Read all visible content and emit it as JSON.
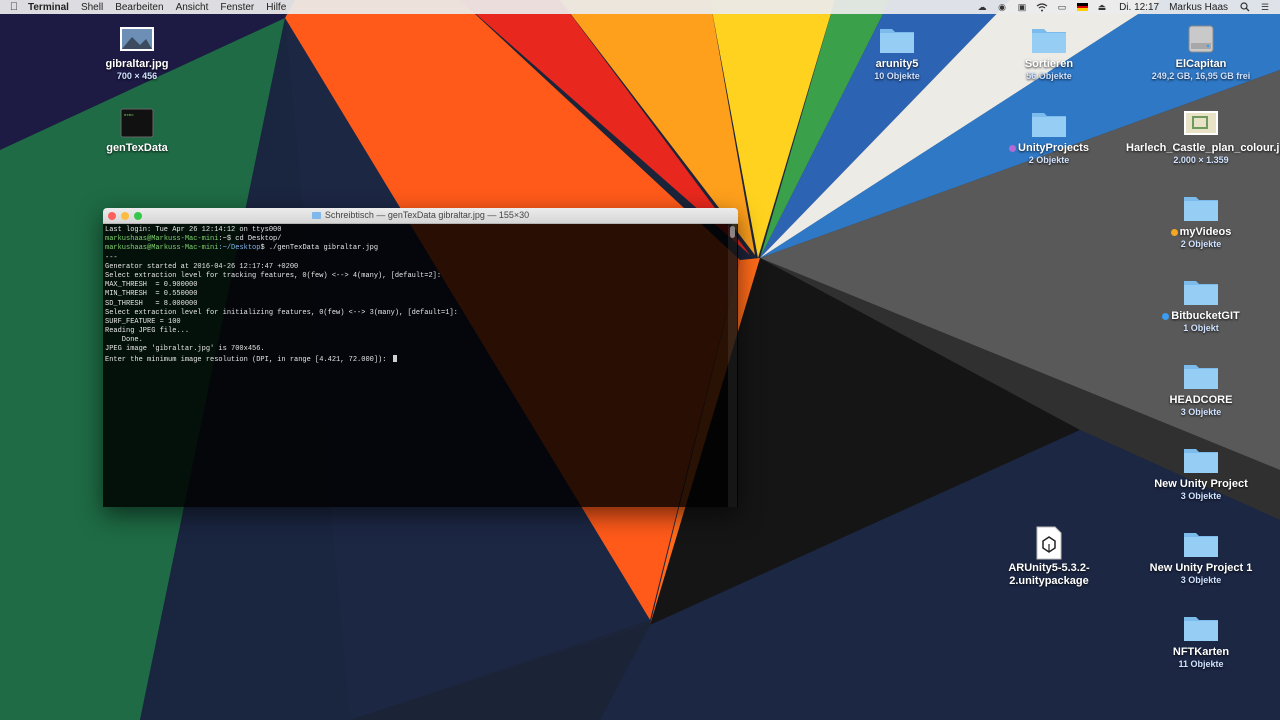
{
  "menubar": {
    "app_name": "Terminal",
    "menus": [
      "Shell",
      "Bearbeiten",
      "Ansicht",
      "Fenster",
      "Hilfe"
    ],
    "clock": "Di. 12:17",
    "user": "Markus Haas",
    "status_icons": [
      "creative-cloud-icon",
      "screen-record-icon",
      "lock-icon",
      "wifi-icon",
      "airplay-icon",
      "german-flag-icon",
      "eject-icon",
      "search-icon",
      "notification-list-icon"
    ]
  },
  "desktop": {
    "icons": [
      {
        "name": "gibraltar.jpg",
        "sub": "700 × 456",
        "type": "image"
      },
      {
        "name": "genTexData",
        "sub": "",
        "type": "exec"
      },
      {
        "name": "arunity5",
        "sub": "10 Objekte",
        "type": "folder"
      },
      {
        "name": "Sortieren",
        "sub": "56 Objekte",
        "type": "folder"
      },
      {
        "name": "ElCapitan",
        "sub": "249,2 GB, 16,95 GB frei",
        "type": "drive"
      },
      {
        "name": "UnityProjects",
        "sub": "2 Objekte",
        "type": "folder"
      },
      {
        "name": "Harlech_Castle_plan_colour.jpg",
        "sub": "2.000 × 1.359",
        "type": "image"
      },
      {
        "name": "myVideos",
        "sub": "2 Objekte",
        "type": "folder"
      },
      {
        "name": "BitbucketGIT",
        "sub": "1 Objekt",
        "type": "folder"
      },
      {
        "name": "HEADCORE",
        "sub": "3 Objekte",
        "type": "folder"
      },
      {
        "name": "New Unity Project",
        "sub": "3 Objekte",
        "type": "folder"
      },
      {
        "name": "ARUnity5-5.3.2-2.unitypackage",
        "sub": "",
        "type": "package"
      },
      {
        "name": "New Unity Project 1",
        "sub": "3 Objekte",
        "type": "folder"
      },
      {
        "name": "NFTKarten",
        "sub": "11 Objekte",
        "type": "folder"
      }
    ]
  },
  "terminal": {
    "title": "Schreibtisch — genTexData gibraltar.jpg — 155×30",
    "lines": {
      "login": "Last login: Tue Apr 26 12:14:12 on ttys000",
      "prompt1_user": "markushaas",
      "prompt1_host": "@Markuss-Mac-mini",
      "prompt1_rest": ":~$ cd Desktop/",
      "prompt2_user": "markushaas",
      "prompt2_host": "@Markuss-Mac-mini",
      "prompt2_path": ":~/Desktop",
      "prompt2_rest": "$ ./genTexData gibraltar.jpg",
      "sep": "---",
      "started": "Generator started at 2016-04-26 12:17:47 +0200",
      "select1": "Select extraction level for tracking features, 0(few) <--> 4(many), [default=2]:",
      "max_thresh": "MAX_THRESH  = 0.900000",
      "min_thresh": "MIN_THRESH  = 0.550000",
      "sd_thresh": "SD_THRESH   = 8.000000",
      "select2": "Select extraction level for initializing features, 0(few) <--> 3(many), [default=1]:",
      "surf": "SURF_FEATURE = 100",
      "reading": "Reading JPEG file...",
      "done": "    Done.",
      "jpeg": "JPEG image 'gibraltar.jpg' is 700x456.",
      "enter": "Enter the minimum image resolution (DPI, in range [4.421, 72.000]): "
    }
  },
  "colors": {
    "folder_blue": "#7cbcec",
    "menu_bg": "#ececec",
    "tag_orange": "#f5a623",
    "tag_blue": "#3b9cf0",
    "tag_purple": "#b36ad3",
    "terminal_bg": "#000000",
    "prompt_green": "#7fd36b"
  }
}
